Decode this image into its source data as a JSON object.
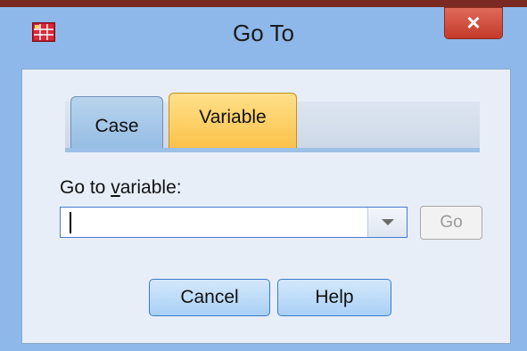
{
  "window": {
    "title": "Go To",
    "close_label": "×",
    "app_icon": "spss-data-grid-icon"
  },
  "tabs": [
    {
      "label": "Case",
      "selected": false
    },
    {
      "label": "Variable",
      "selected": true
    }
  ],
  "field": {
    "label_prefix": "Go to ",
    "label_accel": "v",
    "label_suffix": "ariable:",
    "value": ""
  },
  "buttons": {
    "go": "Go",
    "cancel": "Cancel",
    "help": "Help"
  },
  "colors": {
    "frame": "#8eb8ea",
    "active_tab": "#fbc24a",
    "close": "#c43a2b"
  }
}
